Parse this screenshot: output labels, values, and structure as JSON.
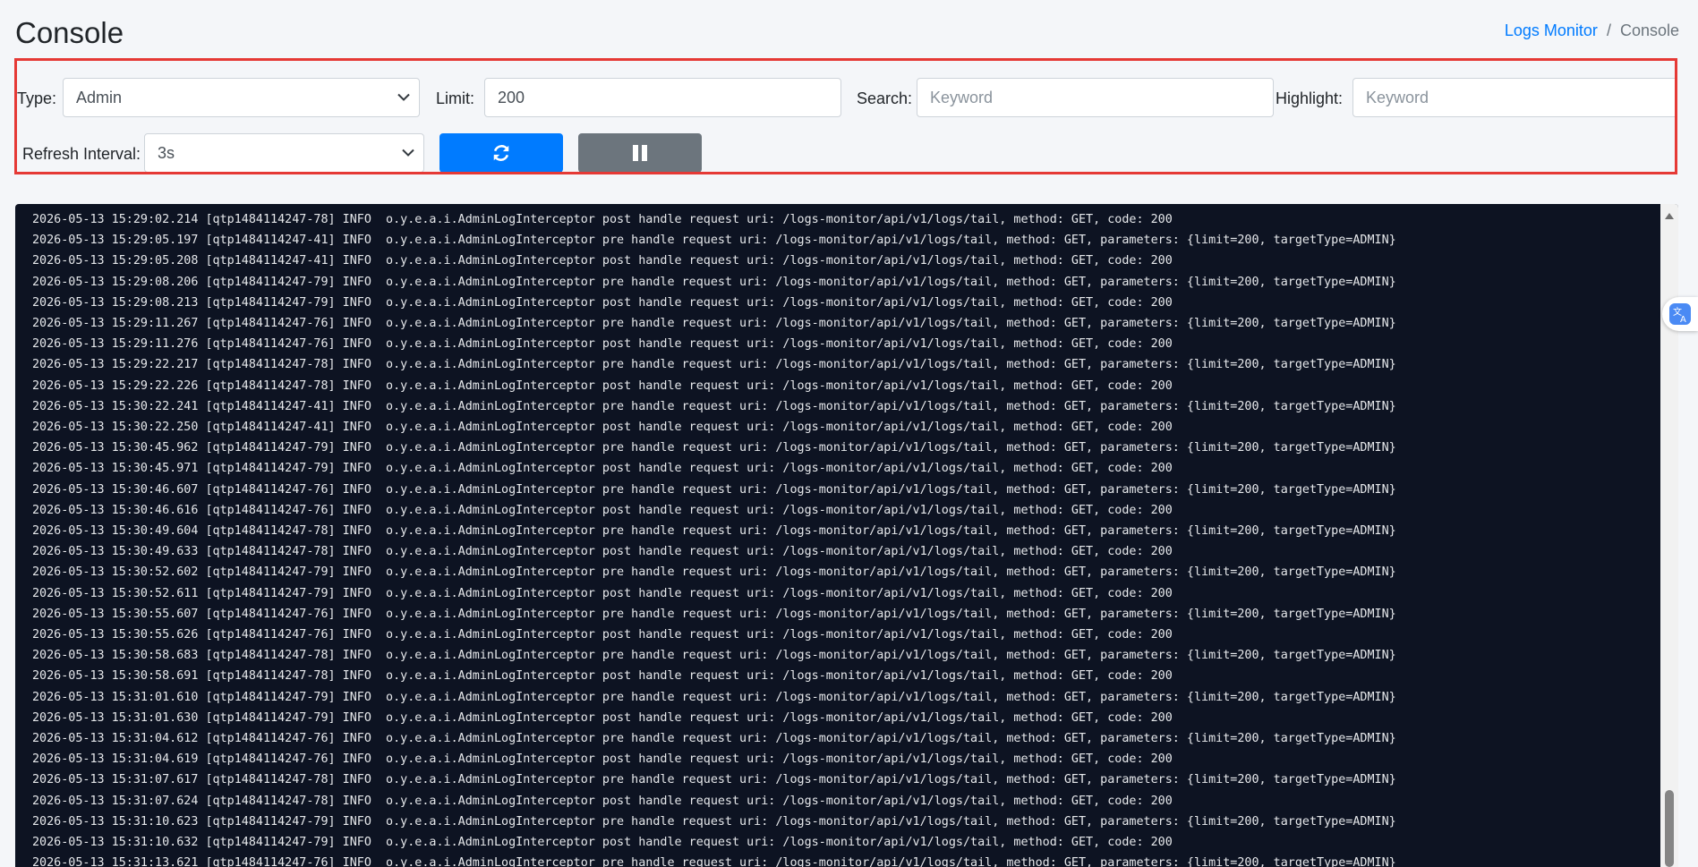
{
  "header": {
    "title": "Console",
    "breadcrumb": {
      "parent": "Logs Monitor",
      "separator": "/",
      "current": "Console"
    }
  },
  "filters": {
    "type_label": "Type:",
    "type_value": "Admin",
    "limit_label": "Limit:",
    "limit_value": "200",
    "search_label": "Search:",
    "search_placeholder": "Keyword",
    "highlight_label": "Highlight:",
    "highlight_placeholder": "Keyword",
    "refresh_label": "Refresh Interval:",
    "refresh_value": "3s"
  },
  "icons": {
    "refresh": "refresh-icon",
    "pause": "pause-icon",
    "translate": "translate-icon"
  },
  "colors": {
    "accent": "#007bff",
    "secondary": "#6c757d",
    "highlight_border": "#e53935",
    "log_bg": "#0d1322"
  },
  "logs": [
    "2026-05-13 15:29:02.214 [qtp1484114247-78] INFO  o.y.e.a.i.AdminLogInterceptor post handle request uri: /logs-monitor/api/v1/logs/tail, method: GET, code: 200",
    "2026-05-13 15:29:05.197 [qtp1484114247-41] INFO  o.y.e.a.i.AdminLogInterceptor pre handle request uri: /logs-monitor/api/v1/logs/tail, method: GET, parameters: {limit=200, targetType=ADMIN}",
    "2026-05-13 15:29:05.208 [qtp1484114247-41] INFO  o.y.e.a.i.AdminLogInterceptor post handle request uri: /logs-monitor/api/v1/logs/tail, method: GET, code: 200",
    "2026-05-13 15:29:08.206 [qtp1484114247-79] INFO  o.y.e.a.i.AdminLogInterceptor pre handle request uri: /logs-monitor/api/v1/logs/tail, method: GET, parameters: {limit=200, targetType=ADMIN}",
    "2026-05-13 15:29:08.213 [qtp1484114247-79] INFO  o.y.e.a.i.AdminLogInterceptor post handle request uri: /logs-monitor/api/v1/logs/tail, method: GET, code: 200",
    "2026-05-13 15:29:11.267 [qtp1484114247-76] INFO  o.y.e.a.i.AdminLogInterceptor pre handle request uri: /logs-monitor/api/v1/logs/tail, method: GET, parameters: {limit=200, targetType=ADMIN}",
    "2026-05-13 15:29:11.276 [qtp1484114247-76] INFO  o.y.e.a.i.AdminLogInterceptor post handle request uri: /logs-monitor/api/v1/logs/tail, method: GET, code: 200",
    "2026-05-13 15:29:22.217 [qtp1484114247-78] INFO  o.y.e.a.i.AdminLogInterceptor pre handle request uri: /logs-monitor/api/v1/logs/tail, method: GET, parameters: {limit=200, targetType=ADMIN}",
    "2026-05-13 15:29:22.226 [qtp1484114247-78] INFO  o.y.e.a.i.AdminLogInterceptor post handle request uri: /logs-monitor/api/v1/logs/tail, method: GET, code: 200",
    "2026-05-13 15:30:22.241 [qtp1484114247-41] INFO  o.y.e.a.i.AdminLogInterceptor pre handle request uri: /logs-monitor/api/v1/logs/tail, method: GET, parameters: {limit=200, targetType=ADMIN}",
    "2026-05-13 15:30:22.250 [qtp1484114247-41] INFO  o.y.e.a.i.AdminLogInterceptor post handle request uri: /logs-monitor/api/v1/logs/tail, method: GET, code: 200",
    "2026-05-13 15:30:45.962 [qtp1484114247-79] INFO  o.y.e.a.i.AdminLogInterceptor pre handle request uri: /logs-monitor/api/v1/logs/tail, method: GET, parameters: {limit=200, targetType=ADMIN}",
    "2026-05-13 15:30:45.971 [qtp1484114247-79] INFO  o.y.e.a.i.AdminLogInterceptor post handle request uri: /logs-monitor/api/v1/logs/tail, method: GET, code: 200",
    "2026-05-13 15:30:46.607 [qtp1484114247-76] INFO  o.y.e.a.i.AdminLogInterceptor pre handle request uri: /logs-monitor/api/v1/logs/tail, method: GET, parameters: {limit=200, targetType=ADMIN}",
    "2026-05-13 15:30:46.616 [qtp1484114247-76] INFO  o.y.e.a.i.AdminLogInterceptor post handle request uri: /logs-monitor/api/v1/logs/tail, method: GET, code: 200",
    "2026-05-13 15:30:49.604 [qtp1484114247-78] INFO  o.y.e.a.i.AdminLogInterceptor pre handle request uri: /logs-monitor/api/v1/logs/tail, method: GET, parameters: {limit=200, targetType=ADMIN}",
    "2026-05-13 15:30:49.633 [qtp1484114247-78] INFO  o.y.e.a.i.AdminLogInterceptor post handle request uri: /logs-monitor/api/v1/logs/tail, method: GET, code: 200",
    "2026-05-13 15:30:52.602 [qtp1484114247-79] INFO  o.y.e.a.i.AdminLogInterceptor pre handle request uri: /logs-monitor/api/v1/logs/tail, method: GET, parameters: {limit=200, targetType=ADMIN}",
    "2026-05-13 15:30:52.611 [qtp1484114247-79] INFO  o.y.e.a.i.AdminLogInterceptor post handle request uri: /logs-monitor/api/v1/logs/tail, method: GET, code: 200",
    "2026-05-13 15:30:55.607 [qtp1484114247-76] INFO  o.y.e.a.i.AdminLogInterceptor pre handle request uri: /logs-monitor/api/v1/logs/tail, method: GET, parameters: {limit=200, targetType=ADMIN}",
    "2026-05-13 15:30:55.626 [qtp1484114247-76] INFO  o.y.e.a.i.AdminLogInterceptor post handle request uri: /logs-monitor/api/v1/logs/tail, method: GET, code: 200",
    "2026-05-13 15:30:58.683 [qtp1484114247-78] INFO  o.y.e.a.i.AdminLogInterceptor pre handle request uri: /logs-monitor/api/v1/logs/tail, method: GET, parameters: {limit=200, targetType=ADMIN}",
    "2026-05-13 15:30:58.691 [qtp1484114247-78] INFO  o.y.e.a.i.AdminLogInterceptor post handle request uri: /logs-monitor/api/v1/logs/tail, method: GET, code: 200",
    "2026-05-13 15:31:01.610 [qtp1484114247-79] INFO  o.y.e.a.i.AdminLogInterceptor pre handle request uri: /logs-monitor/api/v1/logs/tail, method: GET, parameters: {limit=200, targetType=ADMIN}",
    "2026-05-13 15:31:01.630 [qtp1484114247-79] INFO  o.y.e.a.i.AdminLogInterceptor post handle request uri: /logs-monitor/api/v1/logs/tail, method: GET, code: 200",
    "2026-05-13 15:31:04.612 [qtp1484114247-76] INFO  o.y.e.a.i.AdminLogInterceptor pre handle request uri: /logs-monitor/api/v1/logs/tail, method: GET, parameters: {limit=200, targetType=ADMIN}",
    "2026-05-13 15:31:04.619 [qtp1484114247-76] INFO  o.y.e.a.i.AdminLogInterceptor post handle request uri: /logs-monitor/api/v1/logs/tail, method: GET, code: 200",
    "2026-05-13 15:31:07.617 [qtp1484114247-78] INFO  o.y.e.a.i.AdminLogInterceptor pre handle request uri: /logs-monitor/api/v1/logs/tail, method: GET, parameters: {limit=200, targetType=ADMIN}",
    "2026-05-13 15:31:07.624 [qtp1484114247-78] INFO  o.y.e.a.i.AdminLogInterceptor post handle request uri: /logs-monitor/api/v1/logs/tail, method: GET, code: 200",
    "2026-05-13 15:31:10.623 [qtp1484114247-79] INFO  o.y.e.a.i.AdminLogInterceptor pre handle request uri: /logs-monitor/api/v1/logs/tail, method: GET, parameters: {limit=200, targetType=ADMIN}",
    "2026-05-13 15:31:10.632 [qtp1484114247-79] INFO  o.y.e.a.i.AdminLogInterceptor post handle request uri: /logs-monitor/api/v1/logs/tail, method: GET, code: 200",
    "2026-05-13 15:31:13.621 [qtp1484114247-76] INFO  o.y.e.a.i.AdminLogInterceptor pre handle request uri: /logs-monitor/api/v1/logs/tail, method: GET, parameters: {limit=200, targetType=ADMIN}"
  ]
}
